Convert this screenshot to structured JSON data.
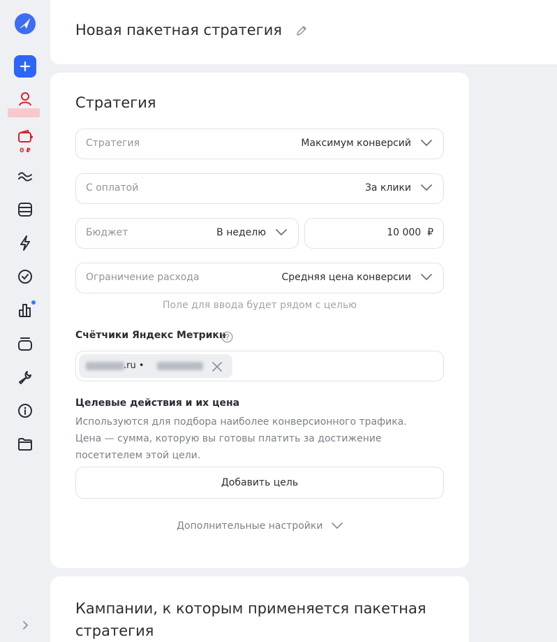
{
  "sidebar": {
    "wallet_amount": "0 ₽",
    "items": [
      {
        "name": "logo-icon"
      },
      {
        "name": "plus-icon"
      },
      {
        "name": "user-icon"
      },
      {
        "name": "wallet-icon"
      },
      {
        "name": "waves-icon"
      },
      {
        "name": "database-icon"
      },
      {
        "name": "lightning-icon"
      },
      {
        "name": "check-circle-icon"
      },
      {
        "name": "bar-chart-icon"
      },
      {
        "name": "layers-icon"
      },
      {
        "name": "wrench-icon"
      },
      {
        "name": "info-icon"
      },
      {
        "name": "folder-icon"
      },
      {
        "name": "chevron-right-icon"
      }
    ]
  },
  "header": {
    "title": "Новая пакетная стратегия"
  },
  "strategy": {
    "section_title": "Стратегия",
    "strategy_field": {
      "label": "Стратегия",
      "value": "Максимум конверсий"
    },
    "payment_field": {
      "label": "С оплатой",
      "value": "За клики"
    },
    "budget_field": {
      "label": "Бюджет",
      "value": "В неделю"
    },
    "budget_amount": "10 000  ₽",
    "limit_field": {
      "label": "Ограничение расхода",
      "value": "Средняя цена конверсии"
    },
    "hint": "Поле для ввода будет рядом с целью",
    "metrika_label": "Счётчики Яндекс Метрики",
    "metrika_chip": ".ru •",
    "goals_title": "Целевые действия и их цена",
    "goals_description": "Используются для подбора наиболее конверсионного трафика. Цена — сумма, которую вы готовы платить за достижение посетителем этой цели.",
    "add_goal_label": "Добавить цель",
    "more_settings_label": "Дополнительные настройки"
  },
  "campaigns": {
    "title": "Кампании, к которым применяется пакетная стратегия"
  },
  "colors": {
    "accent": "#2d66f5",
    "danger": "#d8222a",
    "background": "#eef0f4"
  }
}
